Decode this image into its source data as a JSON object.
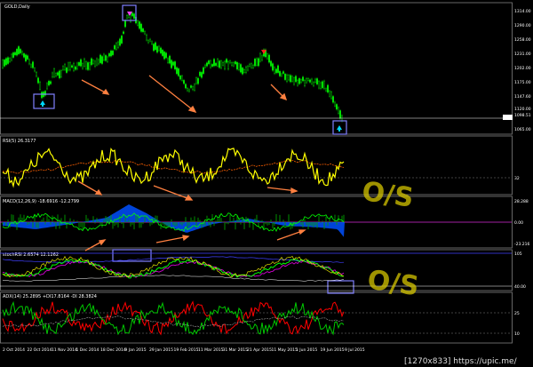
{
  "title": "GOLD,Daily",
  "indicators": {
    "rsi": "RSI(5) 26.3177",
    "macd": "MACD(12,26,9) -18.6916 -12.2799",
    "stoch": "stochRSI 2.6574 12.1262",
    "adx": "ADX(14) 25.2895 +DI17.8164 -DI 28.3824"
  },
  "price_axis": [
    "1314.00",
    "1290.00",
    "1258.00",
    "1231.00",
    "1202.00",
    "1175.00",
    "1147.60",
    "1120.00",
    "1098.51",
    "1065.00"
  ],
  "rsi_axis": [
    "32"
  ],
  "macd_axis": [
    "28.288",
    "0.00",
    "-23.216"
  ],
  "stoch_axis": [
    "105",
    "40.00"
  ],
  "adx_axis": [
    "25",
    "10"
  ],
  "dates": [
    "2 Oct 2014",
    "22 Oct 2014",
    "11 Nov 2014",
    "1 Dec 2014",
    "18 Dec 2014",
    "9 Jan 2015",
    "29 Jan 2015",
    "19 Feb 2015",
    "11 Mar 2015",
    "31 Mar 2015",
    "21 Apr 2015",
    "11 May 2015",
    "1 Jun 2015",
    "19 Jun 2015",
    "9 Jul 2015"
  ],
  "annotations": {
    "hand1": "O/S",
    "hand2": "O/S"
  },
  "watermark": "[1270x833]   https://upic.me/",
  "colors": {
    "bg": "#000000",
    "candles": "#00c800",
    "rsi": "#ffff00",
    "macd_hist": "#00a000",
    "macd_fill": "#0050ff",
    "stoch_main": "#00ff00",
    "stoch_sig": "#d000d0",
    "plus_di": "#ff0000",
    "minus_di": "#00c800",
    "arrows": "#ff8040",
    "boxes": "#8080ff"
  }
}
